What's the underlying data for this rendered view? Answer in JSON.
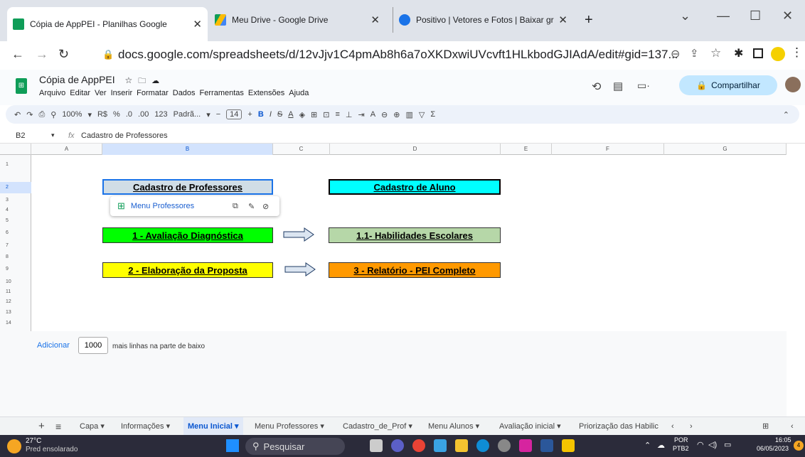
{
  "browser": {
    "tabs": [
      {
        "title": "Cópia de AppPEI - Planilhas Google",
        "active": true
      },
      {
        "title": "Meu Drive - Google Drive",
        "active": false
      },
      {
        "title": "Positivo | Vetores e Fotos | Baixar gr",
        "active": false
      }
    ],
    "new_tab": "+",
    "url": "docs.google.com/spreadsheets/d/12vJjv1C4pmAb8h6a7oXKDxwiUVcvft1HLkbodGJIAdA/edit#gid=137..."
  },
  "doc": {
    "title": "Cópia de AppPEI",
    "menu": [
      "Arquivo",
      "Editar",
      "Ver",
      "Inserir",
      "Formatar",
      "Dados",
      "Ferramentas",
      "Extensões",
      "Ajuda"
    ],
    "share_label": "Compartilhar"
  },
  "toolbar": {
    "zoom": "100%",
    "currency": "R$",
    "percent": "%",
    "dec_less": ".0",
    "dec_more": ".00",
    "num_format": "123",
    "font": "Padrã...",
    "font_size": "14"
  },
  "formula_bar": {
    "cell_ref": "B2",
    "fx": "fx",
    "content": "Cadastro de Professores"
  },
  "grid": {
    "columns": [
      "A",
      "B",
      "C",
      "D",
      "E",
      "F",
      "G"
    ],
    "rows": [
      "1",
      "2",
      "3",
      "4",
      "5",
      "6",
      "7",
      "8",
      "9",
      "10",
      "11",
      "12",
      "13",
      "14"
    ],
    "cells": {
      "b2": "Cadastro de Professores",
      "d2": "Cadastro de Aluno",
      "b6": "1 - Avaliação Diagnóstica",
      "d6": "1.1-  Habilidades Escolares",
      "b9": "2 - Elaboração da Proposta",
      "d9": "3 - Relatório - PEI Completo"
    },
    "popup_link": "Menu Professores",
    "colors": {
      "b2": "#d0dde6",
      "d2": "#00ffff",
      "b6": "#00ff00",
      "d6": "#b6d7a8",
      "b9": "#ffff00",
      "d9": "#ff9900"
    }
  },
  "add_rows": {
    "button": "Adicionar",
    "count": "1000",
    "text": "mais linhas na parte de baixo"
  },
  "sheets": [
    "Capa",
    "Informações",
    "Menu Inicial",
    "Menu Professores",
    "Cadastro_de_Prof",
    "Menu Alunos",
    "Avaliação inicial",
    "Priorização das Habilic"
  ],
  "active_sheet": "Menu Inicial",
  "taskbar": {
    "weather_temp": "27°C",
    "weather_desc": "Pred ensolarado",
    "search": "Pesquisar",
    "lang_1": "POR",
    "lang_2": "PTB2",
    "time": "16:05",
    "date": "06/05/2023",
    "notif": "4"
  }
}
